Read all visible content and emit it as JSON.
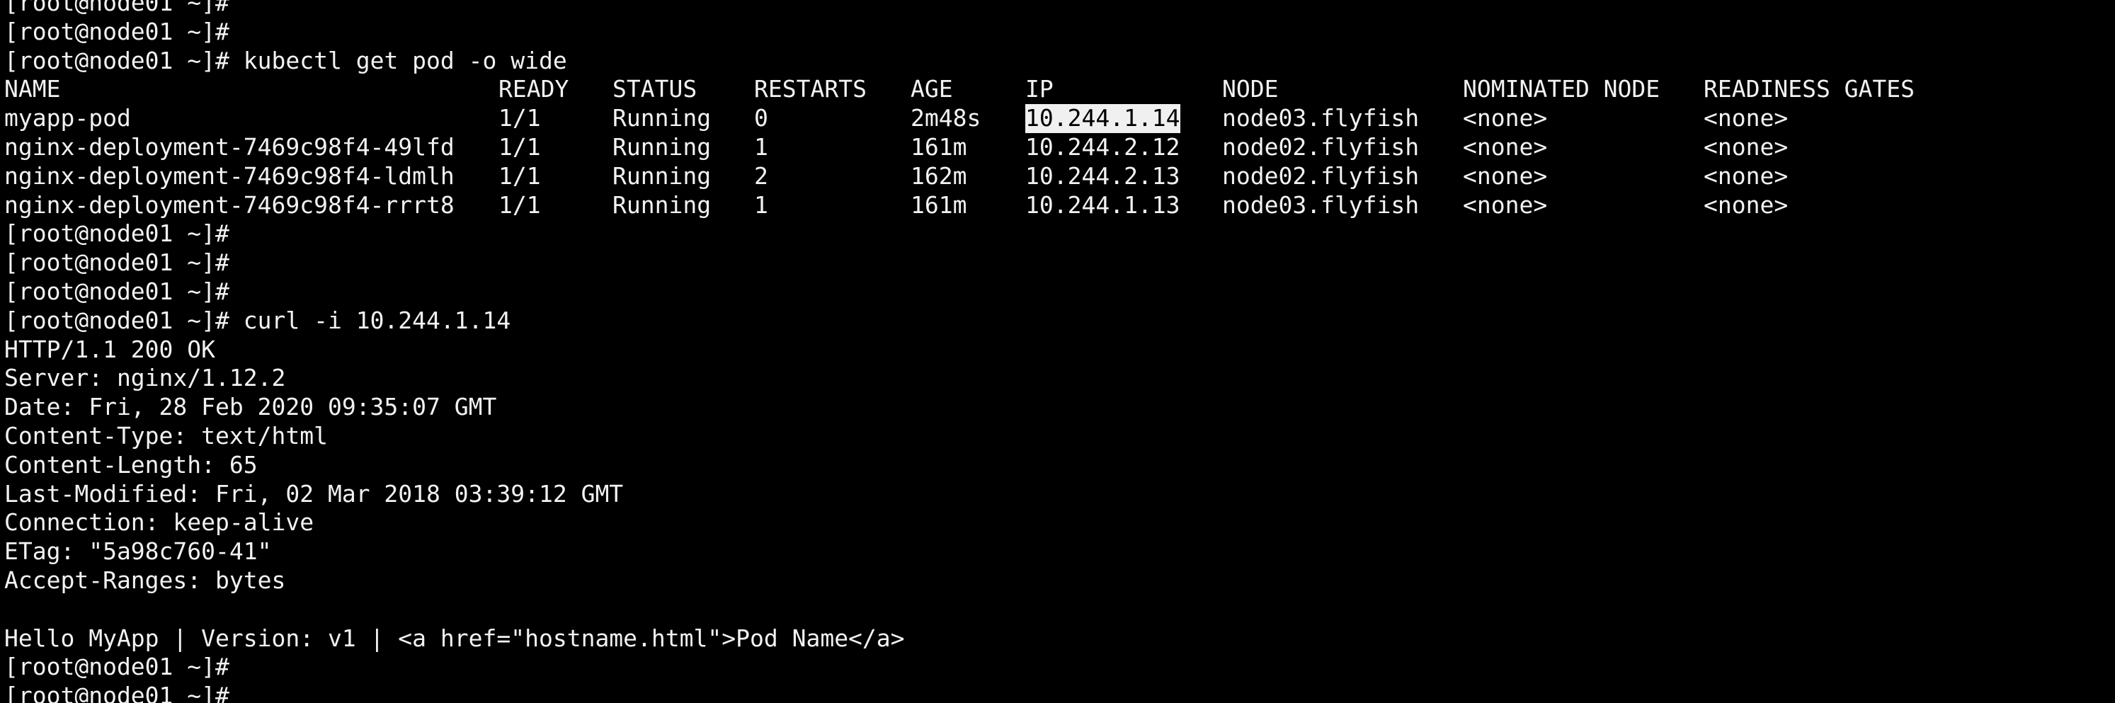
{
  "terminal": {
    "prompt": "[root@node01 ~]#",
    "lines_before": [
      {
        "prompt": "[root@node01 ~]#",
        "command": ""
      }
    ],
    "command_1": "kubectl get pod -o wide",
    "table": {
      "headers": [
        "NAME",
        "READY",
        "STATUS",
        "RESTARTS",
        "AGE",
        "IP",
        "NODE",
        "NOMINATED NODE",
        "READINESS GATES"
      ],
      "rows": [
        [
          "myapp-pod",
          "1/1",
          "Running",
          "0",
          "2m48s",
          "10.244.1.14",
          "node03.flyfish",
          "<none>",
          "<none>"
        ],
        [
          "nginx-deployment-7469c98f4-49lfd",
          "1/1",
          "Running",
          "1",
          "161m",
          "10.244.2.12",
          "node02.flyfish",
          "<none>",
          "<none>"
        ],
        [
          "nginx-deployment-7469c98f4-ldmlh",
          "1/1",
          "Running",
          "2",
          "162m",
          "10.244.2.13",
          "node02.flyfish",
          "<none>",
          "<none>"
        ],
        [
          "nginx-deployment-7469c98f4-rrrt8",
          "1/1",
          "Running",
          "1",
          "161m",
          "10.244.1.13",
          "node03.flyfish",
          "<none>",
          "<none>"
        ]
      ]
    },
    "command_2": "curl -i 10.244.1.14",
    "response": [
      "HTTP/1.1 200 OK",
      "Server: nginx/1.12.2",
      "Date: Fri, 28 Feb 2020 09:35:07 GMT",
      "Content-Type: text/html",
      "Content-Length: 65",
      "Last-Modified: Fri, 02 Mar 2018 03:39:12 GMT",
      "Connection: keep-alive",
      "ETag: \"5a98c760-41\"",
      "Accept-Ranges: bytes",
      "",
      "Hello MyApp | Version: v1 | <a href=\"hostname.html\">Pod Name</a>"
    ],
    "selected_text": "10.244.1.14"
  }
}
